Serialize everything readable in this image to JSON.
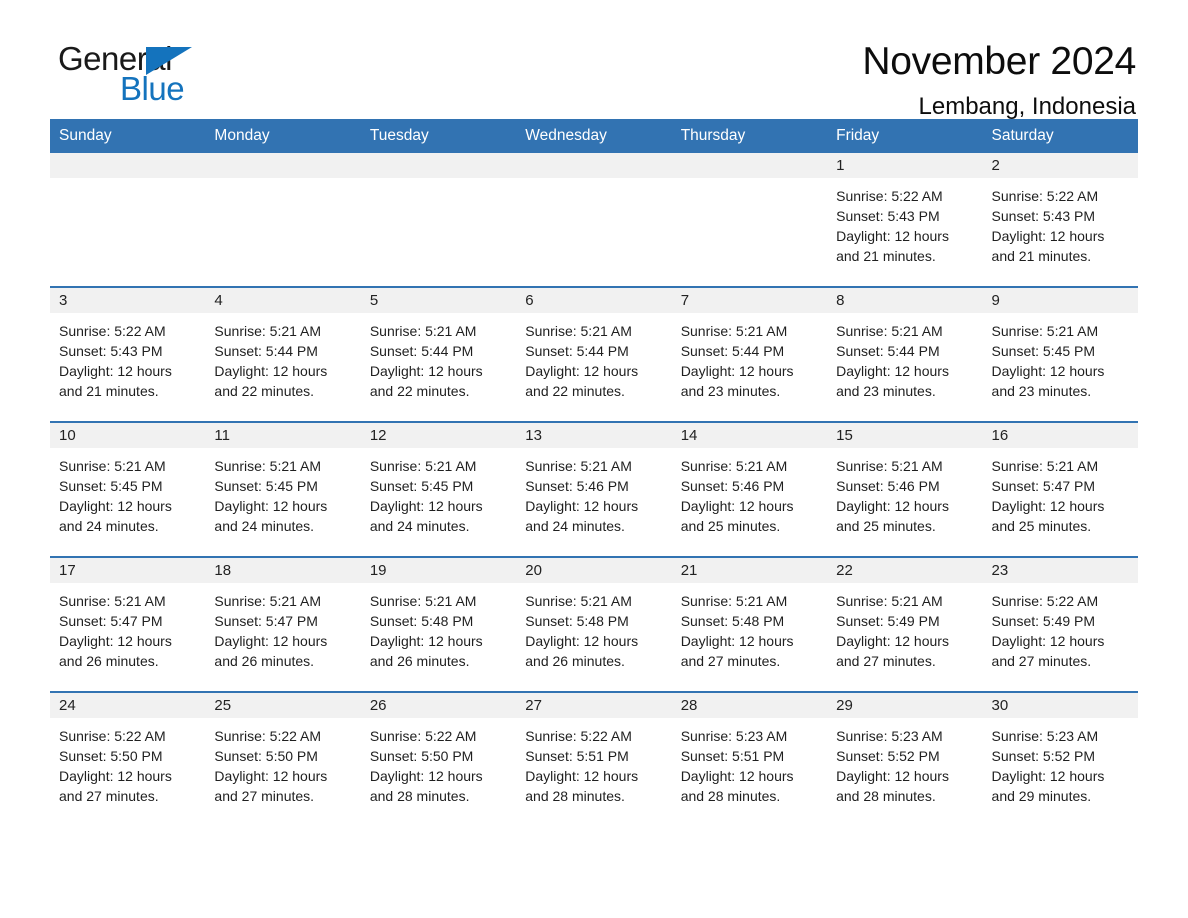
{
  "logo": {
    "word1": "General",
    "word2": "Blue",
    "triangle_color": "#1473bd"
  },
  "header": {
    "title": "November 2024",
    "location": "Lembang, Indonesia"
  },
  "theme": {
    "header_blue": "#3273b2",
    "daynum_band": "#f1f1f1",
    "page_bg": "#ffffff",
    "text": "#1f1f1f"
  },
  "calendar": {
    "weekday_headers": [
      "Sunday",
      "Monday",
      "Tuesday",
      "Wednesday",
      "Thursday",
      "Friday",
      "Saturday"
    ],
    "labels": {
      "sunrise_prefix": "Sunrise:",
      "sunset_prefix": "Sunset:",
      "daylight_prefix": "Daylight:"
    },
    "weeks": [
      [
        {
          "day": "",
          "blank": true
        },
        {
          "day": "",
          "blank": true
        },
        {
          "day": "",
          "blank": true
        },
        {
          "day": "",
          "blank": true
        },
        {
          "day": "",
          "blank": true
        },
        {
          "day": "1",
          "sunrise": "Sunrise: 5:22 AM",
          "sunset": "Sunset: 5:43 PM",
          "daylight": "Daylight: 12 hours and 21 minutes."
        },
        {
          "day": "2",
          "sunrise": "Sunrise: 5:22 AM",
          "sunset": "Sunset: 5:43 PM",
          "daylight": "Daylight: 12 hours and 21 minutes."
        }
      ],
      [
        {
          "day": "3",
          "sunrise": "Sunrise: 5:22 AM",
          "sunset": "Sunset: 5:43 PM",
          "daylight": "Daylight: 12 hours and 21 minutes."
        },
        {
          "day": "4",
          "sunrise": "Sunrise: 5:21 AM",
          "sunset": "Sunset: 5:44 PM",
          "daylight": "Daylight: 12 hours and 22 minutes."
        },
        {
          "day": "5",
          "sunrise": "Sunrise: 5:21 AM",
          "sunset": "Sunset: 5:44 PM",
          "daylight": "Daylight: 12 hours and 22 minutes."
        },
        {
          "day": "6",
          "sunrise": "Sunrise: 5:21 AM",
          "sunset": "Sunset: 5:44 PM",
          "daylight": "Daylight: 12 hours and 22 minutes."
        },
        {
          "day": "7",
          "sunrise": "Sunrise: 5:21 AM",
          "sunset": "Sunset: 5:44 PM",
          "daylight": "Daylight: 12 hours and 23 minutes."
        },
        {
          "day": "8",
          "sunrise": "Sunrise: 5:21 AM",
          "sunset": "Sunset: 5:44 PM",
          "daylight": "Daylight: 12 hours and 23 minutes."
        },
        {
          "day": "9",
          "sunrise": "Sunrise: 5:21 AM",
          "sunset": "Sunset: 5:45 PM",
          "daylight": "Daylight: 12 hours and 23 minutes."
        }
      ],
      [
        {
          "day": "10",
          "sunrise": "Sunrise: 5:21 AM",
          "sunset": "Sunset: 5:45 PM",
          "daylight": "Daylight: 12 hours and 24 minutes."
        },
        {
          "day": "11",
          "sunrise": "Sunrise: 5:21 AM",
          "sunset": "Sunset: 5:45 PM",
          "daylight": "Daylight: 12 hours and 24 minutes."
        },
        {
          "day": "12",
          "sunrise": "Sunrise: 5:21 AM",
          "sunset": "Sunset: 5:45 PM",
          "daylight": "Daylight: 12 hours and 24 minutes."
        },
        {
          "day": "13",
          "sunrise": "Sunrise: 5:21 AM",
          "sunset": "Sunset: 5:46 PM",
          "daylight": "Daylight: 12 hours and 24 minutes."
        },
        {
          "day": "14",
          "sunrise": "Sunrise: 5:21 AM",
          "sunset": "Sunset: 5:46 PM",
          "daylight": "Daylight: 12 hours and 25 minutes."
        },
        {
          "day": "15",
          "sunrise": "Sunrise: 5:21 AM",
          "sunset": "Sunset: 5:46 PM",
          "daylight": "Daylight: 12 hours and 25 minutes."
        },
        {
          "day": "16",
          "sunrise": "Sunrise: 5:21 AM",
          "sunset": "Sunset: 5:47 PM",
          "daylight": "Daylight: 12 hours and 25 minutes."
        }
      ],
      [
        {
          "day": "17",
          "sunrise": "Sunrise: 5:21 AM",
          "sunset": "Sunset: 5:47 PM",
          "daylight": "Daylight: 12 hours and 26 minutes."
        },
        {
          "day": "18",
          "sunrise": "Sunrise: 5:21 AM",
          "sunset": "Sunset: 5:47 PM",
          "daylight": "Daylight: 12 hours and 26 minutes."
        },
        {
          "day": "19",
          "sunrise": "Sunrise: 5:21 AM",
          "sunset": "Sunset: 5:48 PM",
          "daylight": "Daylight: 12 hours and 26 minutes."
        },
        {
          "day": "20",
          "sunrise": "Sunrise: 5:21 AM",
          "sunset": "Sunset: 5:48 PM",
          "daylight": "Daylight: 12 hours and 26 minutes."
        },
        {
          "day": "21",
          "sunrise": "Sunrise: 5:21 AM",
          "sunset": "Sunset: 5:48 PM",
          "daylight": "Daylight: 12 hours and 27 minutes."
        },
        {
          "day": "22",
          "sunrise": "Sunrise: 5:21 AM",
          "sunset": "Sunset: 5:49 PM",
          "daylight": "Daylight: 12 hours and 27 minutes."
        },
        {
          "day": "23",
          "sunrise": "Sunrise: 5:22 AM",
          "sunset": "Sunset: 5:49 PM",
          "daylight": "Daylight: 12 hours and 27 minutes."
        }
      ],
      [
        {
          "day": "24",
          "sunrise": "Sunrise: 5:22 AM",
          "sunset": "Sunset: 5:50 PM",
          "daylight": "Daylight: 12 hours and 27 minutes."
        },
        {
          "day": "25",
          "sunrise": "Sunrise: 5:22 AM",
          "sunset": "Sunset: 5:50 PM",
          "daylight": "Daylight: 12 hours and 27 minutes."
        },
        {
          "day": "26",
          "sunrise": "Sunrise: 5:22 AM",
          "sunset": "Sunset: 5:50 PM",
          "daylight": "Daylight: 12 hours and 28 minutes."
        },
        {
          "day": "27",
          "sunrise": "Sunrise: 5:22 AM",
          "sunset": "Sunset: 5:51 PM",
          "daylight": "Daylight: 12 hours and 28 minutes."
        },
        {
          "day": "28",
          "sunrise": "Sunrise: 5:23 AM",
          "sunset": "Sunset: 5:51 PM",
          "daylight": "Daylight: 12 hours and 28 minutes."
        },
        {
          "day": "29",
          "sunrise": "Sunrise: 5:23 AM",
          "sunset": "Sunset: 5:52 PM",
          "daylight": "Daylight: 12 hours and 28 minutes."
        },
        {
          "day": "30",
          "sunrise": "Sunrise: 5:23 AM",
          "sunset": "Sunset: 5:52 PM",
          "daylight": "Daylight: 12 hours and 29 minutes."
        }
      ]
    ]
  }
}
